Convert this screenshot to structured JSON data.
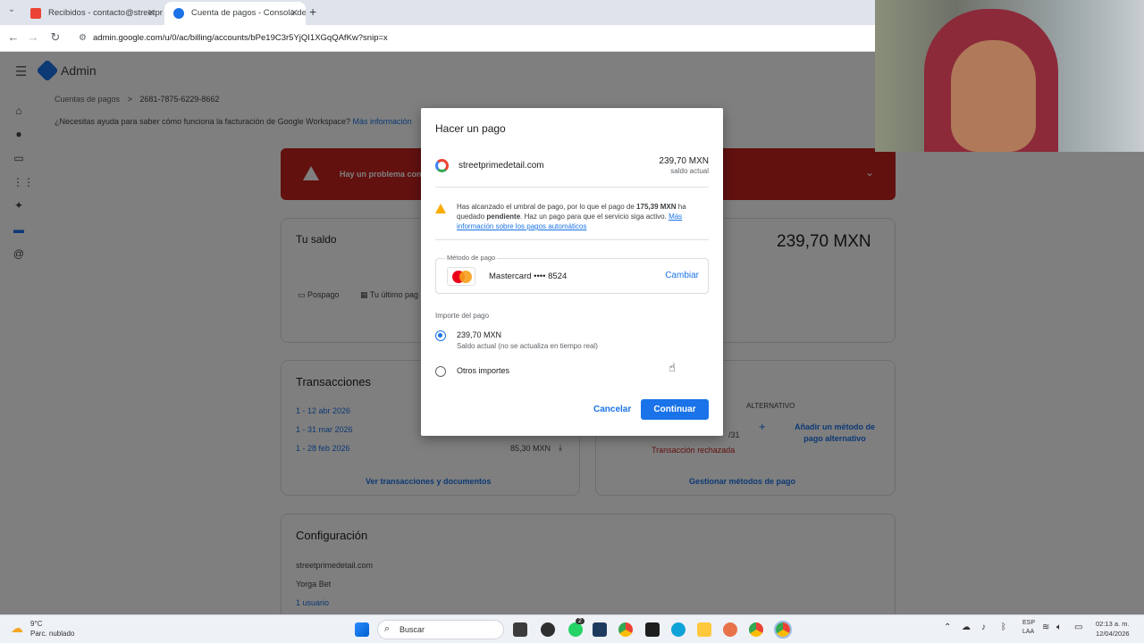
{
  "browser": {
    "tabs": [
      {
        "label": "Recibidos - contacto@streetpri",
        "active": false
      },
      {
        "label": "Cuenta de pagos - Consola de",
        "active": true
      }
    ],
    "new_tab": "+",
    "url": "admin.google.com/u/0/ac/billing/accounts/bPe19C3r5YjQI1XGqQAfKw?snip=x"
  },
  "admin": {
    "brand": "Admin",
    "breadcrumb": {
      "parent": "Cuentas de pagos",
      "separator": ">",
      "current": "2681-7875-6229-8662"
    },
    "help_text": "¿Necesitas ayuda para saber cómo funciona la facturación de Google Workspace?",
    "help_link": "Más información",
    "alert_text": "Hay un problema con",
    "balance": {
      "title": "Tu saldo",
      "amount": "239,70 MXN",
      "plan": "Pospago",
      "last_label": "Tu último pag"
    },
    "transactions": {
      "title": "Transacciones",
      "rows": [
        {
          "date": "1 - 12 abr 2026",
          "amount": ""
        },
        {
          "date": "1 - 31 mar 2026",
          "amount": ""
        },
        {
          "date": "1 - 28 feb 2026",
          "amount": "85,30 MXN"
        }
      ],
      "link": "Ver transacciones y documentos"
    },
    "payment_methods": {
      "alt_label": "ALTERNATIVO",
      "add_alt": "Añadir un método de pago alternativo",
      "card_suffix": "/31",
      "rejected": "Transacción rechazada",
      "link": "Gestionar métodos de pago"
    },
    "settings": {
      "title": "Configuración",
      "rows": [
        "streetprimedetail.com",
        "Yorga Bet",
        "1 usuario"
      ]
    }
  },
  "dialog": {
    "title": "Hacer un pago",
    "account": "streetprimedetail.com",
    "balance_amount": "239,70 MXN",
    "balance_label": "saldo actual",
    "warning_pre": "Has alcanzado el umbral de pago, por lo que el pago de",
    "warning_amount": "175,39 MXN",
    "warning_mid": "ha quedado",
    "warning_status": "pendiente",
    "warning_post": ". Haz un pago para que el servicio siga activo.",
    "warning_link": "Más información sobre los pagos automáticos",
    "method_label": "Método de pago",
    "card_name": "Mastercard •••• 8524",
    "change": "Cambiar",
    "amount_label": "Importe del pago",
    "options": [
      {
        "label": "239,70 MXN",
        "sub": "Saldo actual (no se actualiza en tiempo real)",
        "selected": true
      },
      {
        "label": "Otros importes",
        "sub": "",
        "selected": false
      }
    ],
    "cancel": "Cancelar",
    "continue": "Continuar"
  },
  "taskbar": {
    "weather_temp": "9°C",
    "weather_desc": "Parc. nublado",
    "search": "Buscar",
    "lang_top": "ESP",
    "lang_bottom": "LAA",
    "time": "02:13 a. m.",
    "date": "12/04/2026",
    "whatsapp_badge": "2"
  },
  "colors": {
    "primary": "#1a73e8",
    "alert": "#c5221f",
    "warning": "#f9ab00"
  }
}
